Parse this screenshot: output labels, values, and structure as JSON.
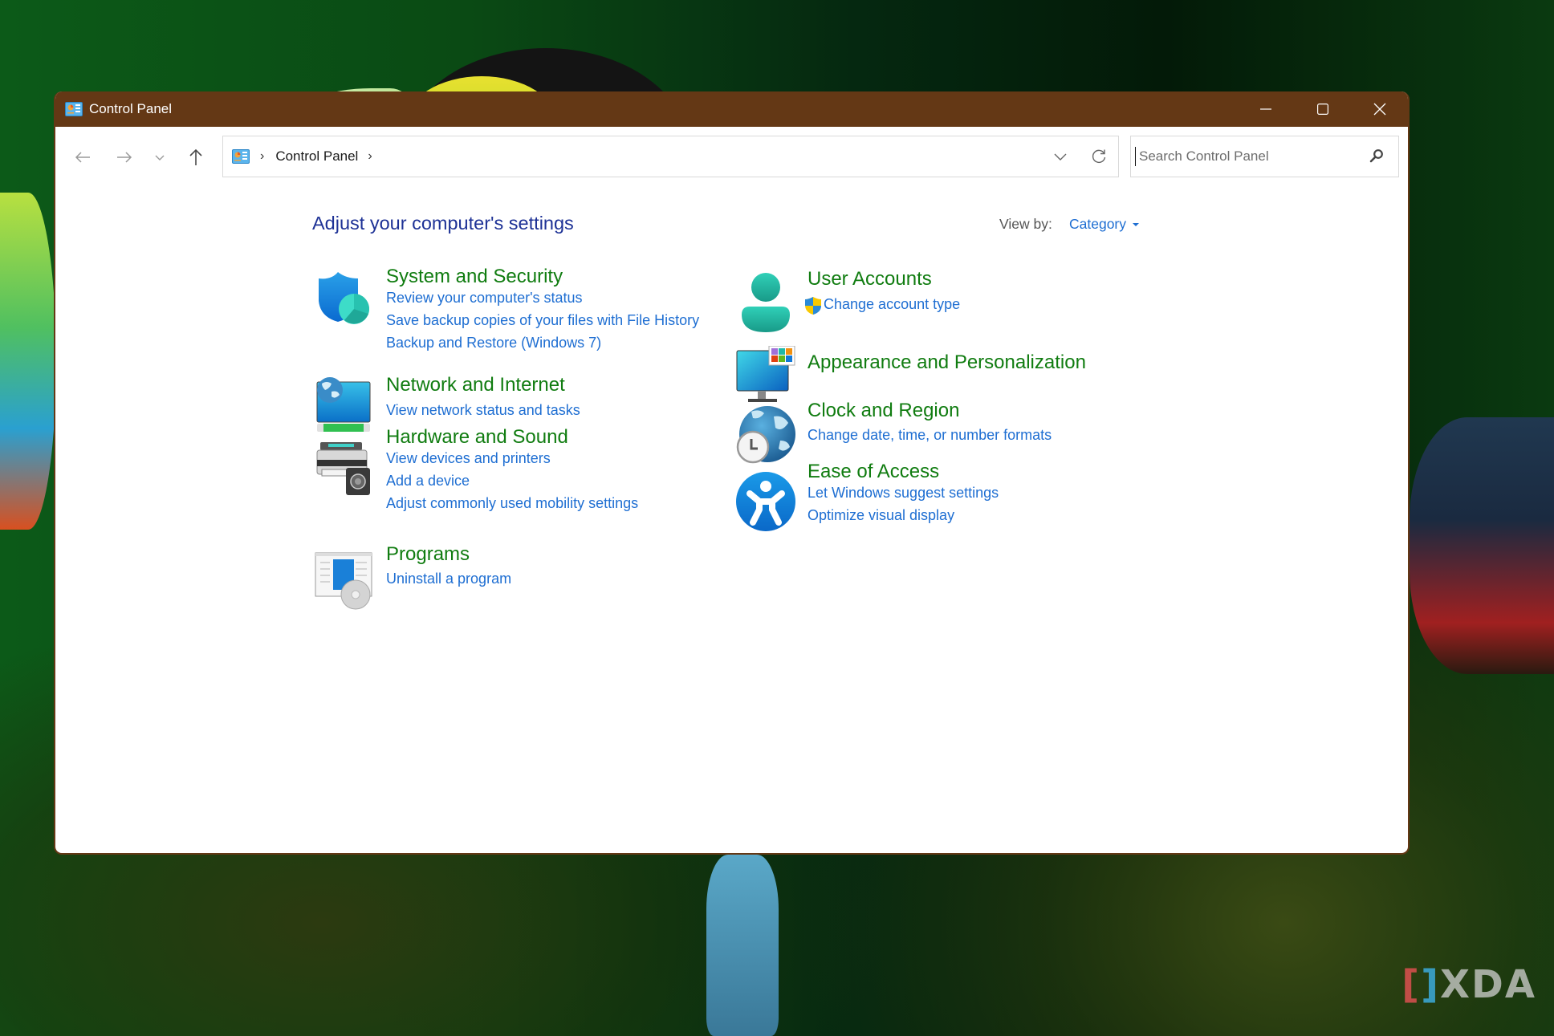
{
  "window": {
    "title": "Control Panel",
    "controls": {
      "minimize": "minimize",
      "maximize": "maximize",
      "close": "close"
    },
    "titlebar_color": "#643815"
  },
  "navigation": {
    "back": "back-arrow",
    "forward": "forward-arrow",
    "recent": "recent-locations",
    "up": "up-arrow"
  },
  "address_bar": {
    "breadcrumbs": [
      "Control Panel"
    ],
    "separator": "›"
  },
  "search": {
    "placeholder": "Search Control Panel",
    "value": ""
  },
  "main": {
    "heading": "Adjust your computer's settings",
    "view_by_label": "View by:",
    "view_by_value": "Category",
    "categories": [
      {
        "title": "System and Security",
        "icon": "shield-icon",
        "links": [
          "Review your computer's status",
          "Save backup copies of your files with File History",
          "Backup and Restore (Windows 7)"
        ]
      },
      {
        "title": "Network and Internet",
        "icon": "network-globe-icon",
        "links": [
          "View network status and tasks"
        ]
      },
      {
        "title": "Hardware and Sound",
        "icon": "printer-speaker-icon",
        "links": [
          "View devices and printers",
          "Add a device",
          "Adjust commonly used mobility settings"
        ]
      },
      {
        "title": "Programs",
        "icon": "programs-disc-icon",
        "links": [
          "Uninstall a program"
        ]
      },
      {
        "title": "User Accounts",
        "icon": "user-icon",
        "links": [
          "Change account type"
        ]
      },
      {
        "title": "Appearance and Personalization",
        "icon": "monitor-palette-icon",
        "links": []
      },
      {
        "title": "Clock and Region",
        "icon": "globe-clock-icon",
        "links": [
          "Change date, time, or number formats"
        ]
      },
      {
        "title": "Ease of Access",
        "icon": "accessibility-icon",
        "links": [
          "Let Windows suggest settings",
          "Optimize visual display"
        ]
      }
    ]
  },
  "colors": {
    "heading": "#1e3296",
    "category_title": "#107c10",
    "link": "#1e6ed2"
  },
  "watermark": "XDA"
}
